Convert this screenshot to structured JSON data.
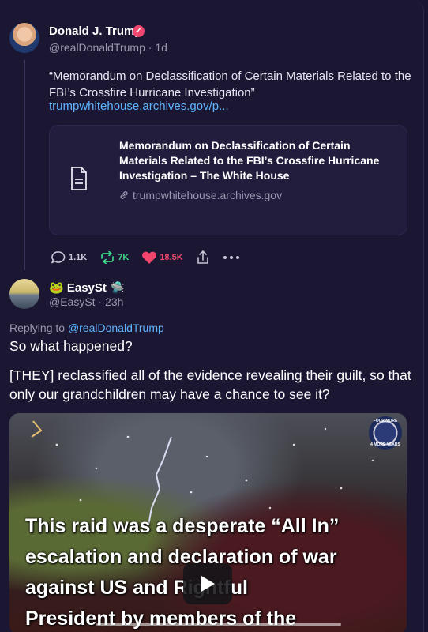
{
  "post": {
    "author_name": "Donald J. Trump",
    "author_handle": "@realDonaldTrump",
    "time": "1d",
    "quote": "“Memorandum on Declassification of Certain Materials Related to the FBI’s Crossfire Hurricane Investigation”",
    "link_text": "trumpwhitehouse.archives.gov/p...",
    "card": {
      "title": "Memorandum on Declassification of Certain Materials Related to the FBI’s Crossfire Hurricane Investigation – The White House",
      "domain": "trumpwhitehouse.archives.gov",
      "icon": "document-icon"
    },
    "actions": {
      "replies": "1.1K",
      "reposts": "7K",
      "likes": "18.5K"
    },
    "colors": {
      "verified": "#f0466e",
      "link": "#5fb4ff",
      "like": "#f0466e",
      "repost": "#3dd68c"
    }
  },
  "reply": {
    "author_name": "EasySt",
    "author_handle": "@EasySt",
    "time": "23h",
    "replying_label": "Replying to ",
    "replying_handle": "@realDonaldTrump",
    "line1": "So what happened?",
    "line2": "[THEY] reclassified all of the evidence revealing their guilt, so that only our grandchildren may have a chance to see it?",
    "media": {
      "caption": "This raid was a desperate “All In”\nescalation and declaration of war\nagainst US and          Rightful\nPresident by members of the",
      "seal_top": "FOUR MORE",
      "seal_bottom": "4 MORE YEARS"
    }
  }
}
